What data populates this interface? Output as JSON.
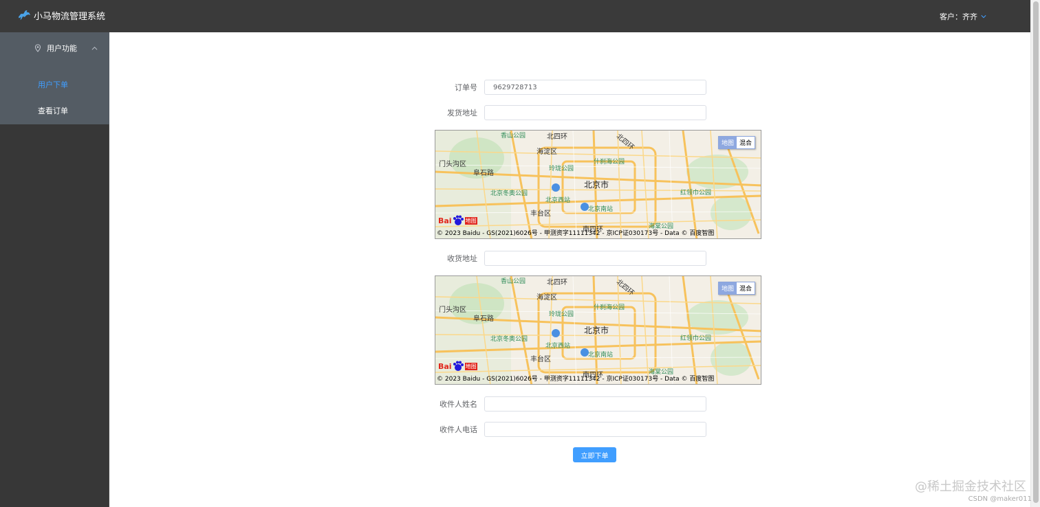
{
  "header": {
    "app_title": "小马物流管理系统",
    "customer_label": "客户：齐齐"
  },
  "sidebar": {
    "group_label": "用户功能",
    "items": [
      {
        "label": "用户下单",
        "active": true
      },
      {
        "label": "查看订单",
        "active": false
      }
    ]
  },
  "form": {
    "order_no": {
      "label": "订单号",
      "value": "9629728713"
    },
    "ship_address": {
      "label": "发货地址",
      "value": ""
    },
    "receive_address": {
      "label": "收货地址",
      "value": ""
    },
    "receiver_name": {
      "label": "收件人姓名",
      "value": ""
    },
    "receiver_phone": {
      "label": "收件人电话",
      "value": ""
    },
    "submit_label": "立即下单"
  },
  "map": {
    "toggle_map": "地图",
    "toggle_hybrid": "混合",
    "logo_bai": "Bai",
    "logo_ditu": "地图",
    "city": "北京市",
    "districts": [
      "海淀区",
      "门头沟区",
      "丰台区",
      "阜石路",
      "北四环",
      "北四环",
      "南四环"
    ],
    "pois": [
      "玲珑公园",
      "什刹海公园",
      "北京冬奥公园",
      "北京西站",
      "北京南站",
      "红领巾公园",
      "海棠公园",
      "香山公园"
    ],
    "copyright": "© 2023 Baidu - GS(2021)6026号 - 甲测资字11111342 - 京ICP证030173号 - Data © 百度智图"
  },
  "watermark": "@稀土掘金技术社区",
  "csdn": "CSDN @maker011",
  "colors": {
    "header_bg": "#3a3a3a",
    "sidebar_bg": "#373737",
    "submenu_bg": "#545c64",
    "accent": "#409eff"
  }
}
